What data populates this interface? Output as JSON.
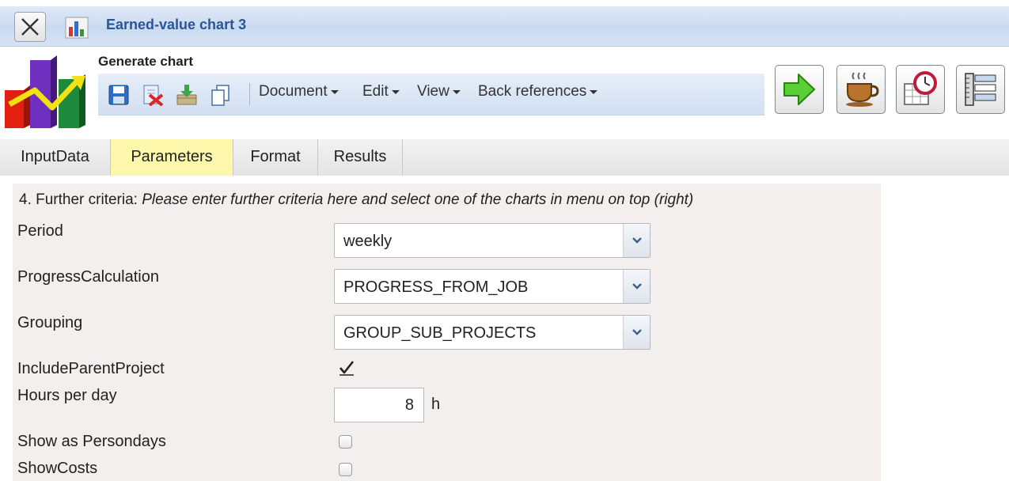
{
  "window": {
    "title": "Earned-value chart 3",
    "close_icon": "close-icon",
    "app_icon": "bar-chart-icon"
  },
  "header": {
    "title": "Generate chart",
    "logo_icon": "chart-logo-icon"
  },
  "toolbar": {
    "icons": [
      "save-icon",
      "delete-icon",
      "import-icon",
      "copy-icon"
    ],
    "menus": [
      {
        "label": "Document"
      },
      {
        "label": "Edit"
      },
      {
        "label": "View"
      },
      {
        "label": "Back references"
      }
    ],
    "right_buttons": [
      "arrow-right-icon",
      "coffee-cup-icon",
      "calendar-clock-icon",
      "ruler-list-icon"
    ]
  },
  "tabs": [
    {
      "label": "InputData",
      "active": false
    },
    {
      "label": "Parameters",
      "active": true
    },
    {
      "label": "Format",
      "active": false
    },
    {
      "label": "Results",
      "active": false
    }
  ],
  "form": {
    "criteria_prefix": "4. Further criteria: ",
    "criteria_hint": "Please enter further criteria here and select one of the charts in menu on top (right)",
    "period": {
      "label": "Period",
      "value": "weekly"
    },
    "progress": {
      "label": "ProgressCalculation",
      "value": "PROGRESS_FROM_JOB"
    },
    "grouping": {
      "label": "Grouping",
      "value": "GROUP_SUB_PROJECTS"
    },
    "include_parent": {
      "label": "IncludeParentProject",
      "checked": true
    },
    "hours": {
      "label": "Hours per day",
      "value": "8",
      "unit": "h"
    },
    "persondays": {
      "label": "Show as Persondays",
      "checked": false
    },
    "costs": {
      "label": "ShowCosts",
      "checked": false
    }
  },
  "colors": {
    "title_text": "#2a5597",
    "active_tab": "#fdf7ab",
    "panel_bg": "#f2efee"
  }
}
